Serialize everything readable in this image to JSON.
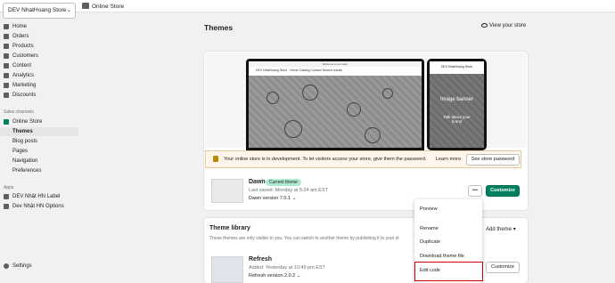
{
  "store_select": "DEV NhatHoang Store",
  "breadcrumb": "Online Store",
  "nav": {
    "items": [
      "Home",
      "Orders",
      "Products",
      "Customers",
      "Content",
      "Analytics",
      "Marketing",
      "Discounts"
    ],
    "sales_channels_label": "Sales channels",
    "online_store": "Online Store",
    "online_store_sub": [
      "Themes",
      "Blog posts",
      "Pages",
      "Navigation",
      "Preferences"
    ],
    "apps_label": "Apps",
    "apps": [
      "DEV Nhật HN Label",
      "Dev Nhật HN Options"
    ],
    "settings": "Settings"
  },
  "page": {
    "title": "Themes",
    "view_store": "View your store"
  },
  "preview": {
    "desktop_store_name": "DEV NhatHoang Store",
    "desktop_welcome": "Welcome to our store",
    "desktop_nav": [
      "Home",
      "Catalog",
      "Contact",
      "Search results"
    ],
    "phone_store_name": "DEV NhatHoang Store",
    "phone_banner": "Image banner",
    "phone_text": "Talk about your brand"
  },
  "banner": {
    "text": "Your online store is in development. To let visitors access your store, give them the password.",
    "learn_more": "Learn more",
    "see_password": "See store password"
  },
  "current_theme": {
    "name": "Dawn",
    "badge": "Current theme",
    "last_saved": "Last saved: Monday at 5:24 am EST",
    "version": "Dawn version 7.0.1",
    "customize": "Customize",
    "more": "•••"
  },
  "library": {
    "title": "Theme library",
    "desc": "These themes are only visible to you. You can switch to another theme by publishing it to your st",
    "add_theme": "Add theme"
  },
  "refresh": {
    "name": "Refresh",
    "added": "Added: Yesterday at 10:49 pm EST",
    "version": "Refresh version 2.0.2",
    "customize": "Customize"
  },
  "menu": [
    "Preview",
    "Rename",
    "Duplicate",
    "Download theme file",
    "Edit code"
  ],
  "colors": {
    "accent": "#008060",
    "highlight": "#d40000"
  }
}
